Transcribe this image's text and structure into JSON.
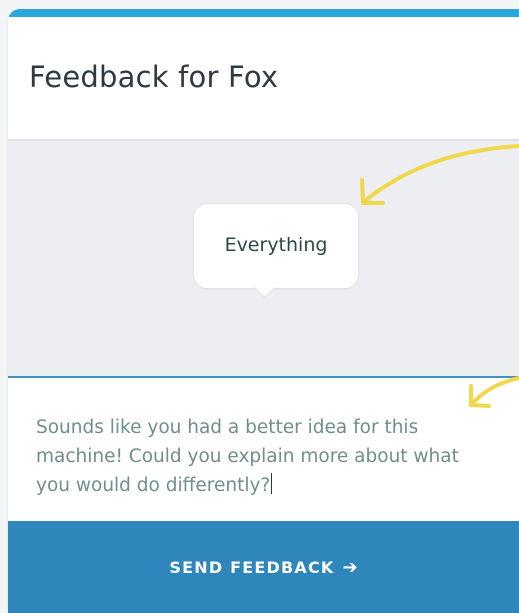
{
  "dialog": {
    "title": "Feedback for Fox"
  },
  "bubble": {
    "text": "Everything"
  },
  "feedback": {
    "text": "Sounds like you had a better idea for this machine! Could you explain more about what you would do differently?"
  },
  "send": {
    "label": "SEND FEEDBACK",
    "icon": "arrow-right-icon"
  },
  "colors": {
    "accent": "#2aa6dc",
    "button": "#2e86bb",
    "annotation_arrow": "#f0d84a"
  }
}
